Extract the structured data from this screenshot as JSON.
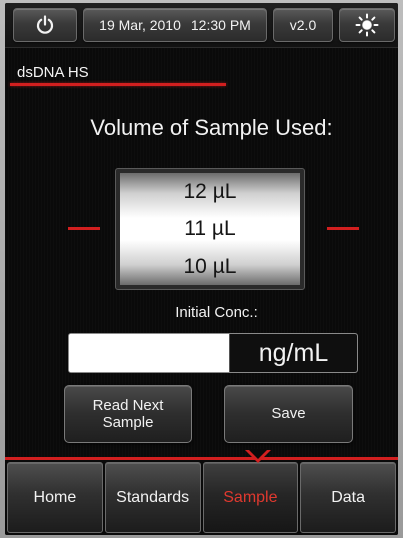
{
  "topbar": {
    "power_icon": "power-icon",
    "date": "19 Mar, 2010",
    "time": "12:30 PM",
    "version": "v2.0",
    "brightness_icon": "brightness-icon"
  },
  "mode": {
    "title": "dsDNA HS"
  },
  "volume": {
    "heading": "Volume of Sample Used:",
    "options": [
      "12 µL",
      "11 µL",
      "10 µL"
    ],
    "selected": "11 µL"
  },
  "concentration": {
    "label": "Initial Conc.:",
    "value": "",
    "unit": "ng/mL"
  },
  "actions": {
    "read_next_label": "Read Next\nSample",
    "save_label": "Save"
  },
  "nav": {
    "tabs": [
      {
        "label": "Home"
      },
      {
        "label": "Standards"
      },
      {
        "label": "Sample"
      },
      {
        "label": "Data"
      }
    ],
    "active": "Sample"
  },
  "colors": {
    "accent": "#d21f1f",
    "active_tab_text": "#e0392f",
    "background": "#0a0a0a"
  }
}
